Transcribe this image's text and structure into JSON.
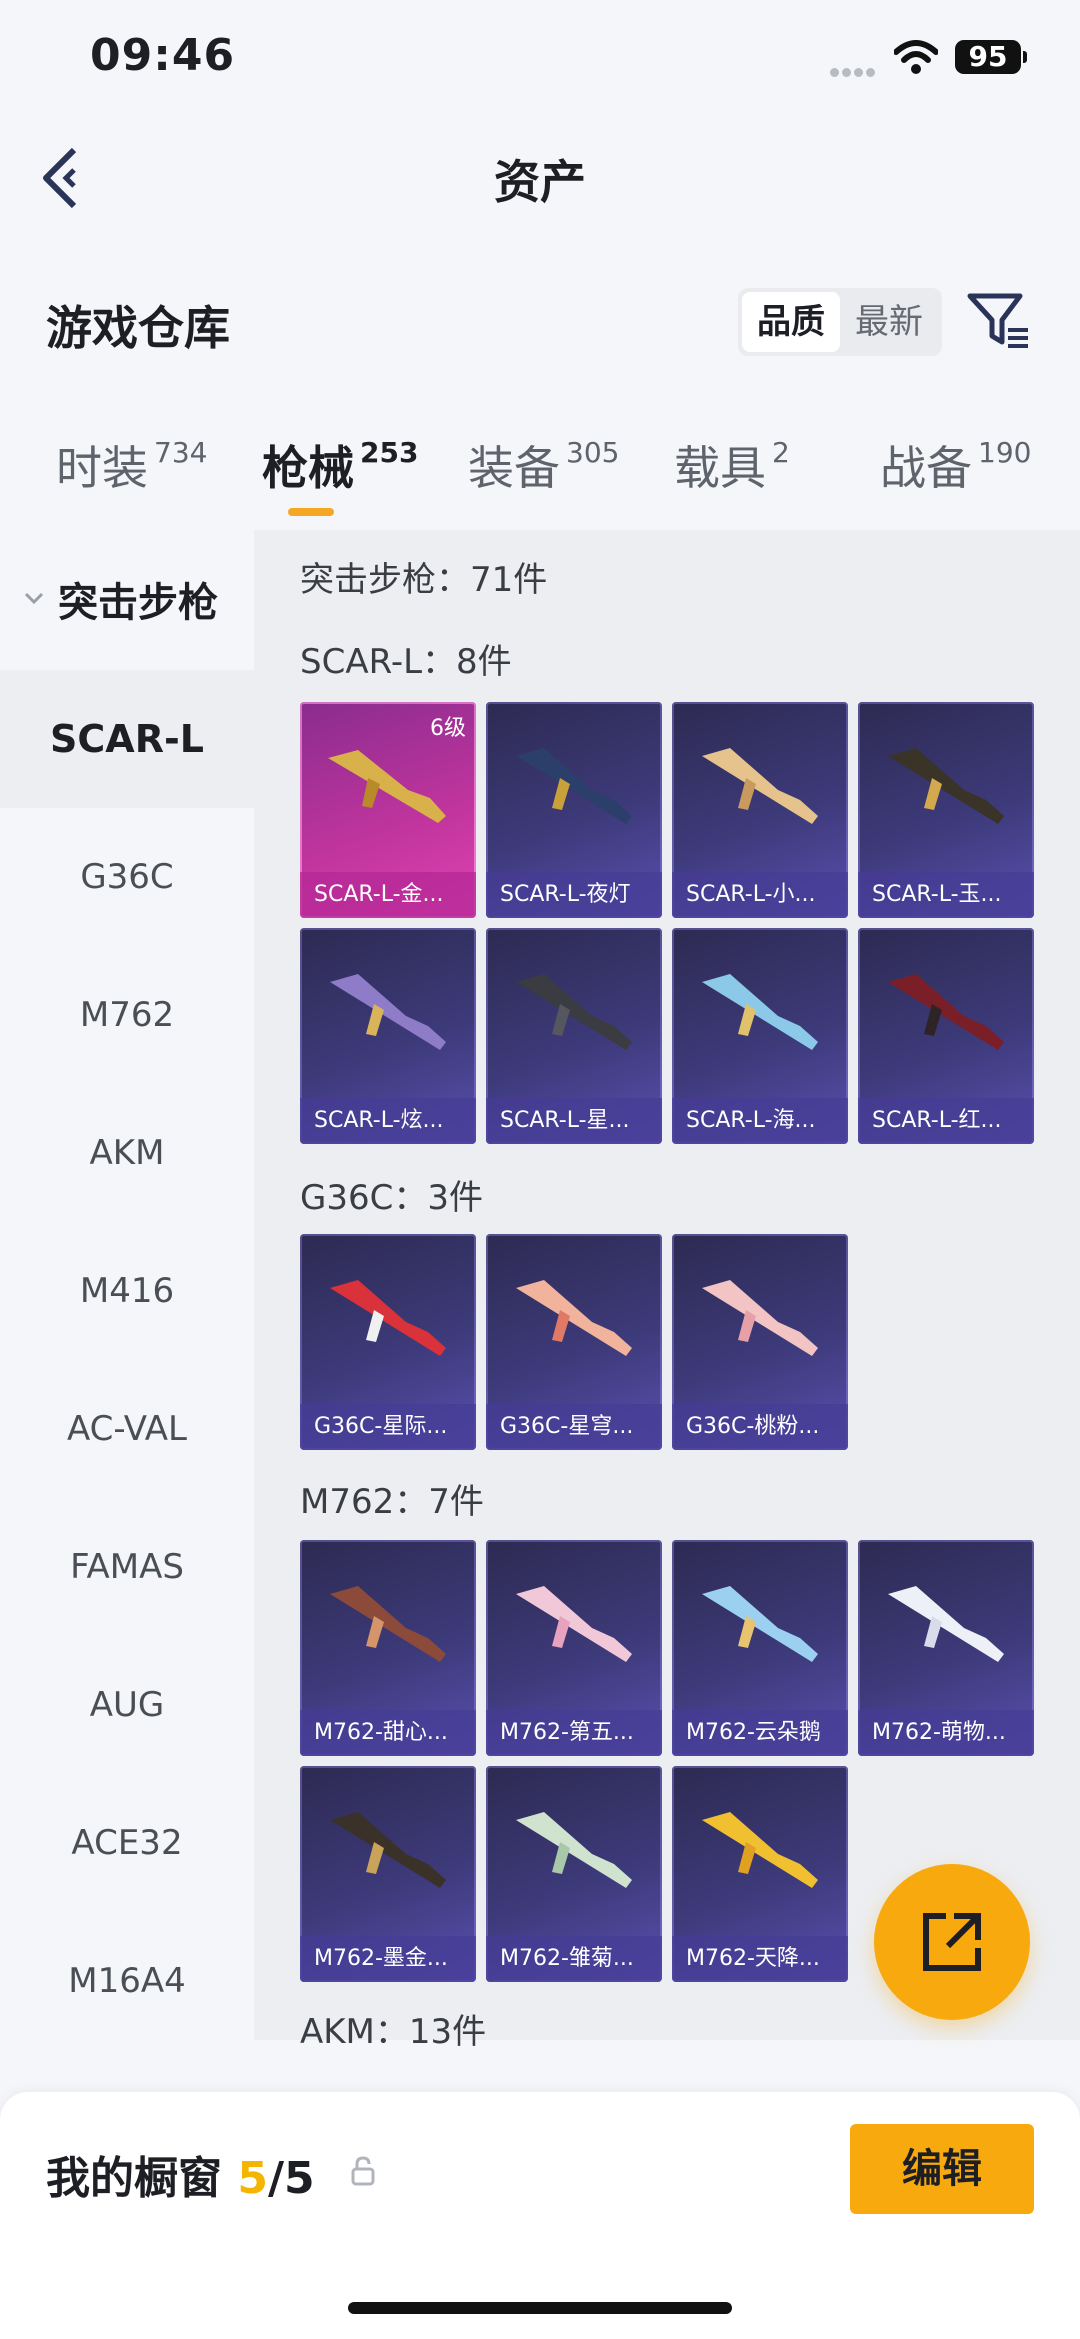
{
  "status_bar": {
    "time": "09:46",
    "battery": "95"
  },
  "nav": {
    "title": "资产",
    "back_icon": "chevron-left-icon"
  },
  "header": {
    "title": "游戏仓库",
    "sort_options": [
      "品质",
      "最新"
    ],
    "sort_selected": "品质",
    "filter_icon": "filter-icon"
  },
  "tabs": [
    {
      "label": "时装",
      "count": "734"
    },
    {
      "label": "枪械",
      "count": "253",
      "active": true
    },
    {
      "label": "装备",
      "count": "305"
    },
    {
      "label": "载具",
      "count": "2"
    },
    {
      "label": "战备",
      "count": "190"
    }
  ],
  "sidebar": {
    "category": "突击步枪",
    "items": [
      "SCAR-L",
      "G36C",
      "M762",
      "AKM",
      "M416",
      "AC-VAL",
      "FAMAS",
      "AUG",
      "ACE32",
      "M16A4"
    ],
    "active": "SCAR-L"
  },
  "main": {
    "category_total": "突击步枪：71件",
    "groups": [
      {
        "title": "SCAR-L：8件",
        "items": [
          {
            "name": "SCAR-L-金...",
            "level": "6级"
          },
          {
            "name": "SCAR-L-夜灯"
          },
          {
            "name": "SCAR-L-小..."
          },
          {
            "name": "SCAR-L-玉..."
          },
          {
            "name": "SCAR-L-炫..."
          },
          {
            "name": "SCAR-L-星..."
          },
          {
            "name": "SCAR-L-海..."
          },
          {
            "name": "SCAR-L-红..."
          }
        ]
      },
      {
        "title": "G36C：3件",
        "items": [
          {
            "name": "G36C-星际..."
          },
          {
            "name": "G36C-星穹..."
          },
          {
            "name": "G36C-桃粉..."
          }
        ]
      },
      {
        "title": "M762：7件",
        "items": [
          {
            "name": "M762-甜心..."
          },
          {
            "name": "M762-第五..."
          },
          {
            "name": "M762-云朵鹅"
          },
          {
            "name": "M762-萌物..."
          },
          {
            "name": "M762-墨金..."
          },
          {
            "name": "M762-雏菊..."
          },
          {
            "name": "M762-天降..."
          }
        ]
      },
      {
        "title": "AKM：13件",
        "items": []
      }
    ]
  },
  "fab": {
    "icon": "share-external-icon"
  },
  "bottom_bar": {
    "label": "我的橱窗",
    "count_current": "5",
    "count_total": "/5",
    "lock_icon": "lock-icon",
    "edit_label": "编辑"
  },
  "colors": {
    "accent": "#f7a90e",
    "card_purple": "#3d3a7a",
    "card_gold": "#c2359e"
  }
}
